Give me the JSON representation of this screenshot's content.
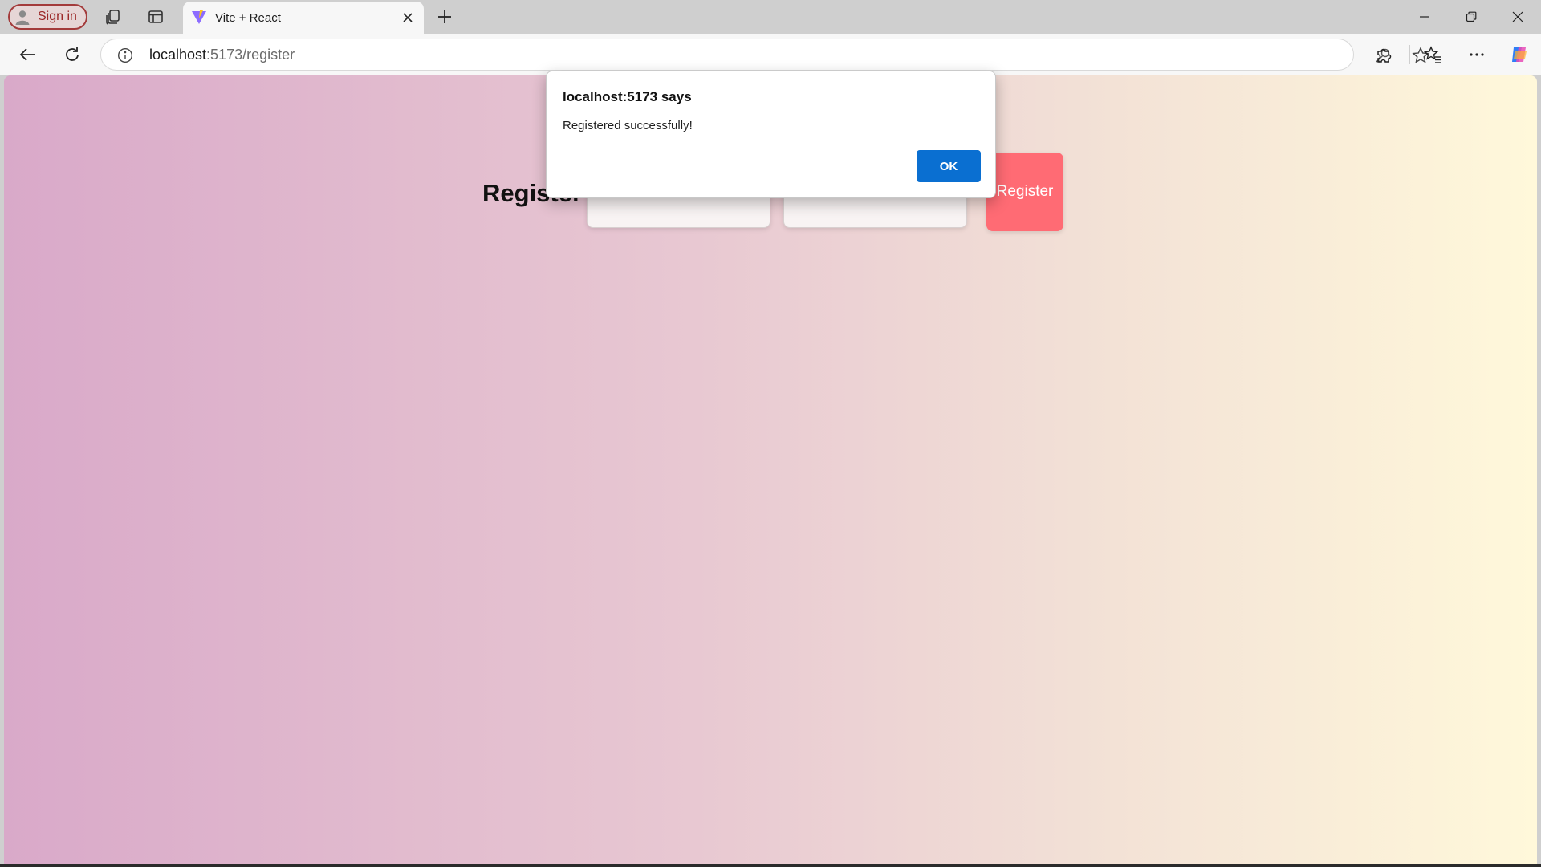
{
  "browser": {
    "signin_label": "Sign in",
    "tab_title": "Vite + React",
    "url_host": "localhost",
    "url_path": ":5173/register",
    "icons": {
      "avatar": "avatar-icon",
      "workspaces": "workspaces-icon",
      "tab_actions": "vertical-tabs-icon",
      "favicon": "vite-logo-icon",
      "close_tab": "close-icon",
      "new_tab": "plus-icon",
      "back": "back-arrow-icon",
      "refresh": "refresh-icon",
      "site_info": "info-icon",
      "password": "key-icon",
      "favorite": "star-icon",
      "extensions": "puzzle-icon",
      "favorites": "favorites-icon",
      "more": "more-icon",
      "copilot": "copilot-icon"
    }
  },
  "page": {
    "title": "Register",
    "inputs": [
      {
        "value": "",
        "placeholder": ""
      },
      {
        "value": "",
        "placeholder": ""
      }
    ],
    "register_button_label": "Register"
  },
  "alert": {
    "title": "localhost:5173 says",
    "message": "Registered successfully!",
    "ok_label": "OK"
  },
  "colors": {
    "register_button": "#ff6b74",
    "ok_button": "#0a6fd1",
    "gradient_left": "#d9a9c9",
    "gradient_right": "#fff8da",
    "signin_accent": "#a33b3b"
  }
}
